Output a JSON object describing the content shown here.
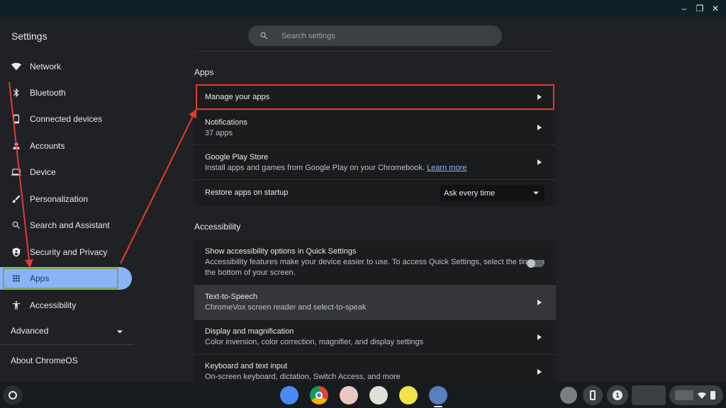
{
  "window": {
    "minimize": "–",
    "restore": "❐",
    "close": "✕"
  },
  "sidebar": {
    "title": "Settings",
    "items": [
      {
        "label": "Network",
        "icon": "wifi-icon"
      },
      {
        "label": "Bluetooth",
        "icon": "bluetooth-icon"
      },
      {
        "label": "Connected devices",
        "icon": "phone-icon"
      },
      {
        "label": "Accounts",
        "icon": "person-icon"
      },
      {
        "label": "Device",
        "icon": "laptop-icon"
      },
      {
        "label": "Personalization",
        "icon": "brush-icon"
      },
      {
        "label": "Search and Assistant",
        "icon": "search-icon"
      },
      {
        "label": "Security and Privacy",
        "icon": "shield-icon"
      },
      {
        "label": "Apps",
        "icon": "apps-grid-icon",
        "active": true
      },
      {
        "label": "Accessibility",
        "icon": "accessibility-icon"
      }
    ],
    "advanced": "Advanced",
    "about": "About ChromeOS"
  },
  "search": {
    "placeholder": "Search settings"
  },
  "apps_section": {
    "title": "Apps",
    "manage": "Manage your apps",
    "notifications": {
      "title": "Notifications",
      "subtitle": "37 apps"
    },
    "play_store": {
      "title": "Google Play Store",
      "subtitle": "Install apps and games from Google Play on your Chromebook.",
      "link": "Learn more"
    },
    "restore": {
      "title": "Restore apps on startup",
      "value": "Ask every time"
    }
  },
  "accessibility_section": {
    "title": "Accessibility",
    "quick_settings": {
      "title": "Show accessibility options in Quick Settings",
      "line1": "Accessibility features make your device easier to use. To access Quick Settings, select the time on",
      "line2": "the bottom of your screen."
    },
    "tts": {
      "title": "Text-to-Speech",
      "subtitle": "ChromeVox screen reader and select-to-speak"
    },
    "display": {
      "title": "Display and magnification",
      "subtitle": "Color inversion, color correction, magnifier, and display settings"
    },
    "keyboard": {
      "title": "Keyboard and text input",
      "subtitle": "On-screen keyboard, dictation, Switch Access, and more"
    }
  },
  "shelf": {
    "notification_count": "1"
  },
  "colors": {
    "accent": "#8ab4f8",
    "annotation_red": "#e53935"
  }
}
